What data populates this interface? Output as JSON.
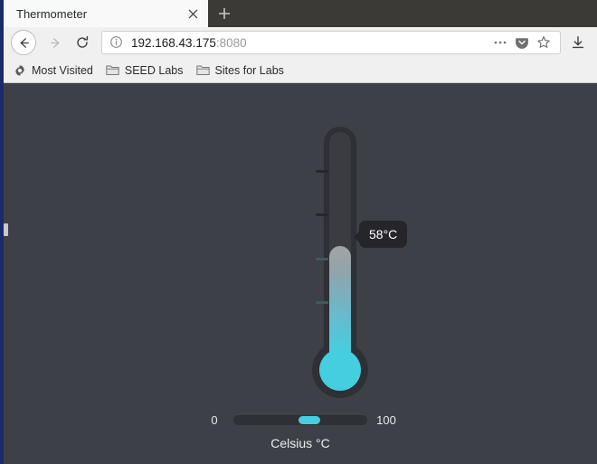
{
  "browser": {
    "tab": {
      "title": "Thermometer",
      "close_icon": "close-icon",
      "newtab_label": "+"
    },
    "nav": {
      "back_icon": "back-arrow-icon",
      "forward_icon": "forward-arrow-icon",
      "reload_icon": "reload-icon"
    },
    "urlbar": {
      "info_icon": "info-circle-icon",
      "host": "192.168.43.175",
      "port": ":8080",
      "full_url": "192.168.43.175:8080",
      "page_actions_icon": "ellipsis-icon",
      "pocket_icon": "pocket-icon",
      "bookmark_icon": "star-icon"
    },
    "downloads_icon": "download-icon",
    "bookmarks": [
      {
        "label": "Most Visited",
        "icon": "gear-icon"
      },
      {
        "label": "SEED Labs",
        "icon": "folder-icon"
      },
      {
        "label": "Sites for Labs",
        "icon": "folder-icon"
      }
    ]
  },
  "page": {
    "title": "Thermometer",
    "caption": "Celsius °C",
    "tooltip": "58°C",
    "slider": {
      "min_label": "0",
      "max_label": "100",
      "value": 58,
      "min": 0,
      "max": 100
    },
    "colors": {
      "background": "#3e4047",
      "accent": "#45cde0",
      "casing": "#2e3036",
      "tooltip_bg": "#26262a",
      "text": "#eeeef0"
    }
  }
}
